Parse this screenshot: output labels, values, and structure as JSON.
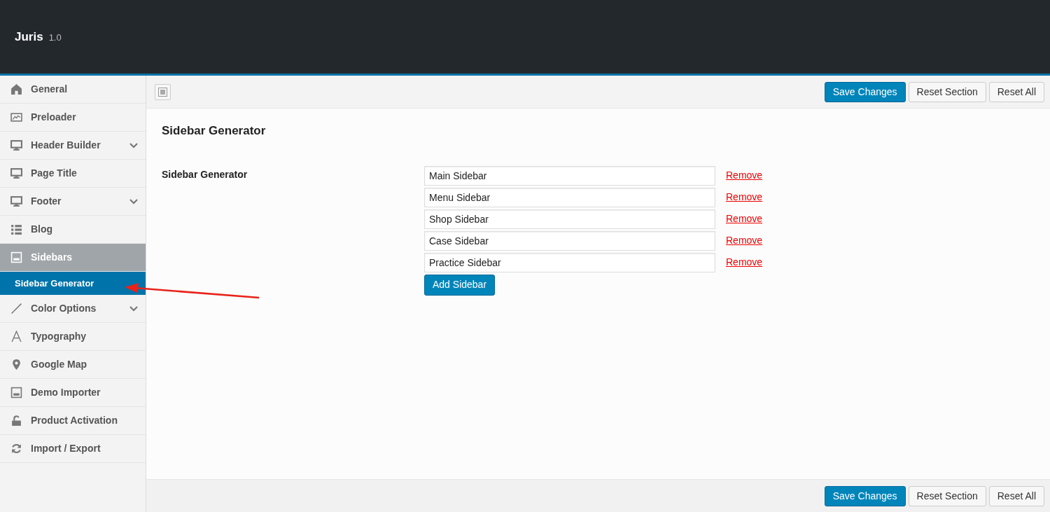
{
  "header": {
    "title": "Juris",
    "version": "1.0"
  },
  "sidebar": {
    "items": [
      {
        "label": "General",
        "kind": "home",
        "expandable": false,
        "selected": false
      },
      {
        "label": "Preloader",
        "kind": "chart",
        "expandable": false,
        "selected": false
      },
      {
        "label": "Header Builder",
        "kind": "monitor",
        "expandable": true,
        "selected": false
      },
      {
        "label": "Page Title",
        "kind": "monitor",
        "expandable": false,
        "selected": false
      },
      {
        "label": "Footer",
        "kind": "monitor",
        "expandable": true,
        "selected": false
      },
      {
        "label": "Blog",
        "kind": "list",
        "expandable": false,
        "selected": false
      },
      {
        "label": "Sidebars",
        "kind": "layout",
        "expandable": false,
        "selected": true,
        "children": [
          {
            "label": "Sidebar Generator",
            "selected": true
          }
        ]
      },
      {
        "label": "Color Options",
        "kind": "brush",
        "expandable": true,
        "selected": false
      },
      {
        "label": "Typography",
        "kind": "letter",
        "expandable": false,
        "selected": false
      },
      {
        "label": "Google Map",
        "kind": "pin",
        "expandable": false,
        "selected": false
      },
      {
        "label": "Demo Importer",
        "kind": "layout",
        "expandable": false,
        "selected": false
      },
      {
        "label": "Product Activation",
        "kind": "lock",
        "expandable": false,
        "selected": false
      },
      {
        "label": "Import / Export",
        "kind": "sync",
        "expandable": false,
        "selected": false
      }
    ]
  },
  "toolbar": {
    "buttons": [
      {
        "label": "Save Changes",
        "primary": true
      },
      {
        "label": "Reset Section",
        "primary": false
      },
      {
        "label": "Reset All",
        "primary": false
      }
    ]
  },
  "section": {
    "title": "Sidebar Generator",
    "field_label": "Sidebar Generator",
    "sidebars": [
      {
        "value": "Main Sidebar",
        "action": "Remove"
      },
      {
        "value": "Menu Sidebar",
        "action": "Remove"
      },
      {
        "value": "Shop Sidebar",
        "action": "Remove"
      },
      {
        "value": "Case Sidebar",
        "action": "Remove"
      },
      {
        "value": "Practice Sidebar",
        "action": "Remove"
      }
    ],
    "add_button": "Add Sidebar"
  },
  "footer": {
    "buttons": [
      {
        "label": "Save Changes",
        "primary": true
      },
      {
        "label": "Reset Section",
        "primary": false
      },
      {
        "label": "Reset All",
        "primary": false
      }
    ]
  }
}
